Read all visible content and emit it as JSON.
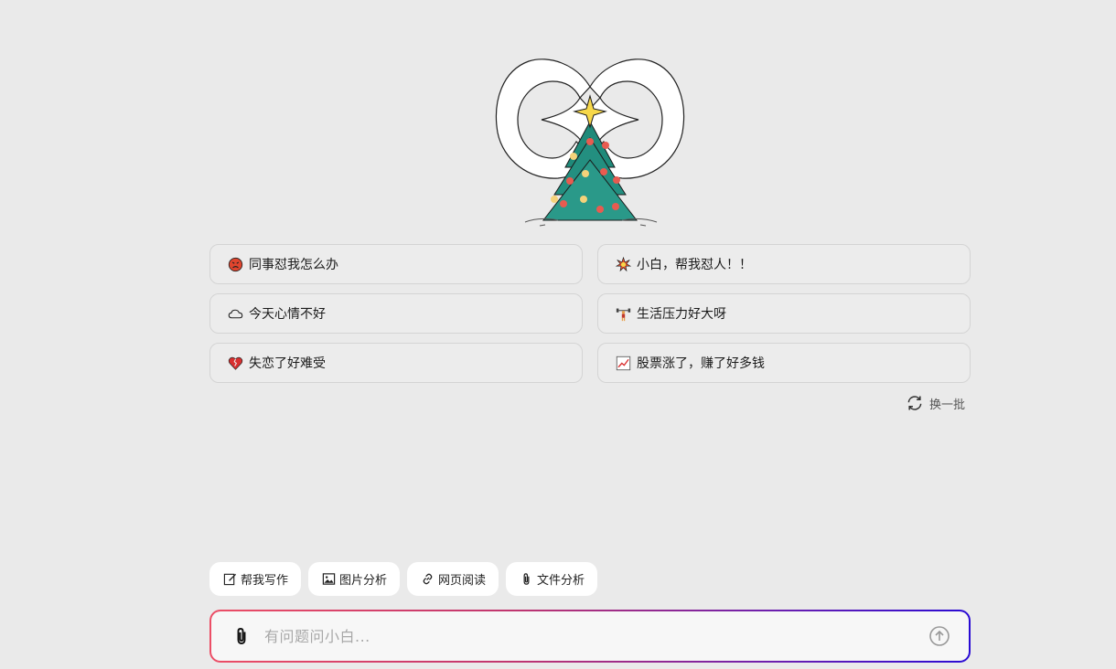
{
  "logo": {
    "icon": "christmas-tree-logo"
  },
  "suggestions": [
    {
      "icon": "angry-face-icon",
      "label": "同事怼我怎么办"
    },
    {
      "icon": "collision-icon",
      "label": "小白，帮我怼人！！"
    },
    {
      "icon": "cloud-icon",
      "label": "今天心情不好"
    },
    {
      "icon": "weightlifter-icon",
      "label": "生活压力好大呀"
    },
    {
      "icon": "broken-heart-icon",
      "label": "失恋了好难受"
    },
    {
      "icon": "chart-increasing-icon",
      "label": "股票涨了，赚了好多钱"
    }
  ],
  "refresh": {
    "label": "换一批",
    "icon": "refresh-icon"
  },
  "tools": [
    {
      "icon": "edit-icon",
      "label": "帮我写作"
    },
    {
      "icon": "image-icon",
      "label": "图片分析"
    },
    {
      "icon": "link-icon",
      "label": "网页阅读"
    },
    {
      "icon": "paperclip-icon",
      "label": "文件分析"
    }
  ],
  "input": {
    "placeholder": "有问题问小白...",
    "value": ""
  },
  "colors": {
    "gradient_start": "#ec4e66",
    "gradient_end": "#2a0bd4",
    "background": "#eaeaea"
  }
}
